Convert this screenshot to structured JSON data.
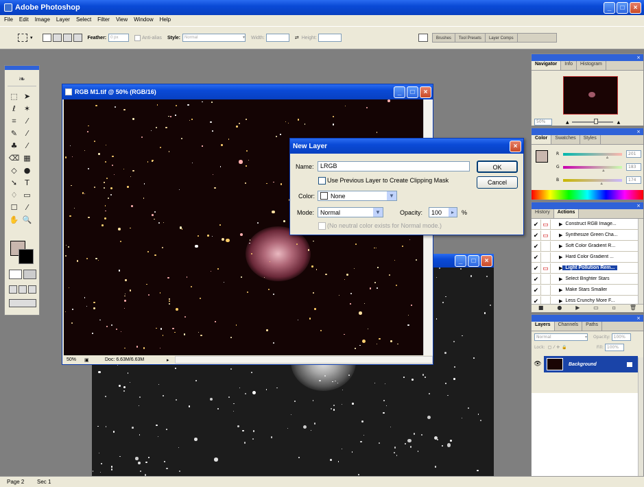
{
  "app": {
    "title": "Adobe Photoshop"
  },
  "menu": [
    "File",
    "Edit",
    "Image",
    "Layer",
    "Select",
    "Filter",
    "View",
    "Window",
    "Help"
  ],
  "options_bar": {
    "feather_label": "Feather:",
    "feather_value": "0 px",
    "antialias_label": "Anti-alias",
    "style_label": "Style:",
    "style_value": "Normal",
    "width_label": "Width:",
    "height_label": "Height:",
    "well_tabs": [
      "Brushes",
      "Tool Presets",
      "Layer Comps"
    ]
  },
  "doc_window": {
    "title": "RGB M1.tif @ 50% (RGB/16)",
    "zoom": "50%",
    "doc_info": "Doc: 6.63M/6.63M"
  },
  "dialog": {
    "title": "New Layer",
    "name_label": "Name:",
    "name_value": "LRGB",
    "clip_label": "Use Previous Layer to Create Clipping Mask",
    "color_label": "Color:",
    "color_value": "None",
    "mode_label": "Mode:",
    "mode_value": "Normal",
    "opacity_label": "Opacity:",
    "opacity_value": "100",
    "opacity_unit": "%",
    "neutral_label": "(No neutral color exists for Normal mode.)",
    "ok_label": "OK",
    "cancel_label": "Cancel"
  },
  "navigator": {
    "tabs": [
      "Navigator",
      "Info",
      "Histogram"
    ],
    "zoom": "50%"
  },
  "color_panel": {
    "tabs": [
      "Color",
      "Swatches",
      "Styles"
    ],
    "channels": [
      {
        "label": "R",
        "value": "201"
      },
      {
        "label": "G",
        "value": "183"
      },
      {
        "label": "B",
        "value": "174"
      }
    ]
  },
  "actions_panel": {
    "tabs": [
      "History",
      "Actions"
    ],
    "items": [
      "Construct RGB Image...",
      "Synthesize Green Cha...",
      "Soft Color Gradient R...",
      "Hard Color Gradient ...",
      "Light Pollution Rem...",
      "Select Brighter Stars",
      "Make Stars Smaller",
      "Less Crunchy More F..."
    ],
    "selected_index": 4
  },
  "layers_panel": {
    "tabs": [
      "Layers",
      "Channels",
      "Paths"
    ],
    "blend_mode": "Normal",
    "opacity_label": "Opacity:",
    "opacity_value": "100%",
    "lock_label": "Lock:",
    "fill_label": "Fill:",
    "fill_value": "100%",
    "layer_name": "Background"
  },
  "status_bar": {
    "page": "Page 2",
    "sec": "Sec 1"
  },
  "colors": {
    "fg": "#c9b7ae",
    "bg": "#000000",
    "xp_blue": "#0a4ad6"
  }
}
